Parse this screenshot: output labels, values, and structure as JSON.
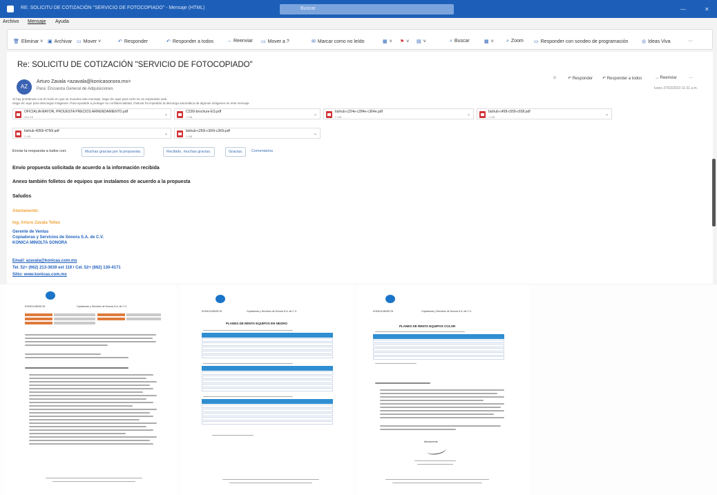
{
  "window": {
    "title": "RE: SOLICITU DE COTIZACIÓN \"SERVICIO DE FOTOCOPIADO\" - Mensaje (HTML)",
    "search_placeholder": "Buscar",
    "min": "—",
    "close": "✕"
  },
  "menu": [
    "Archivo",
    "Mensaje",
    "Ayuda"
  ],
  "ribbon": [
    {
      "icon": "trash-icon",
      "glyph": "🗑",
      "label": "Eliminar ˅"
    },
    {
      "icon": "archive-icon",
      "glyph": "▣",
      "label": "Archivar"
    },
    {
      "icon": "move-icon",
      "glyph": "▭",
      "label": "Mover ˅"
    },
    {
      "icon": "reply-icon",
      "glyph": "↶",
      "label": "Responder"
    },
    {
      "icon": "reply-all-icon",
      "glyph": "↶",
      "label": "Responder a todos"
    },
    {
      "icon": "forward-icon",
      "glyph": "→",
      "label": "Reenviar"
    },
    {
      "icon": "move-to-icon",
      "glyph": "▭",
      "label": "Mover a ?"
    },
    {
      "icon": "mark-read-icon",
      "glyph": "✉",
      "label": "Marcar como no leído"
    },
    {
      "icon": "categorize-icon",
      "glyph": "▦",
      "label": "˅"
    },
    {
      "icon": "flag-icon",
      "glyph": "⚑",
      "label": "˅"
    },
    {
      "icon": "more-icon",
      "glyph": "▤",
      "label": "˅"
    },
    {
      "icon": "find-icon",
      "glyph": "⌕",
      "label": "Buscar"
    },
    {
      "icon": "translate-icon",
      "glyph": "▦",
      "label": "˅"
    },
    {
      "icon": "zoom-icon",
      "glyph": "⌕",
      "label": "Zoom"
    },
    {
      "icon": "teams-reply-icon",
      "glyph": "▭",
      "label": "Responder con sondeo de programación"
    },
    {
      "icon": "ideas-icon",
      "glyph": "◎",
      "label": "Ideas Viva"
    },
    {
      "icon": "overflow-icon",
      "glyph": "",
      "label": "···"
    }
  ],
  "message": {
    "subject": "Re: SOLICITU DE COTIZACIÓN \"SERVICIO DE FOTOCOPIADO\"",
    "avatar": "AZ",
    "sender": "Arturo Zavala <azavala@konicasonora.mx>",
    "to": "Para: Encuesta General de Adquisiciones",
    "notice_1": "Si hay problemas con el modo en que se muestra este mensaje, haga clic aquí para verlo en un explorador web.",
    "notice_2": "Haga clic aquí para descargar imágenes. Para ayudarle a proteger su confidencialidad, Outlook ha impedido la descarga automática de algunas imágenes en este mensaje.",
    "datetime": "lunes 27/03/2023 11:31 a.m.",
    "actions": [
      "☺",
      "↶ Responder",
      "↶ Responder a todos",
      "→ Reenviar",
      "···"
    ],
    "attachments": [
      {
        "name": "OFICIALIA MAYOR, PROUESTA PRECIOS ARRENDAMIENTO.pdf",
        "size": "355 KB"
      },
      {
        "name": "C226i-brochure-ES.pdf",
        "size": "1 MB"
      },
      {
        "name": "bizhub-c224e-c284e-c364e.pdf",
        "size": "2 MB"
      },
      {
        "name": "bizhub-c458-c558-c658.pdf",
        "size": "1 MB"
      },
      {
        "name": "bizhub 4050i-4750i.pdf",
        "size": "2 MB"
      },
      {
        "name": "bizhub-c250i-c300i-c360i.pdf",
        "size": "4 MB"
      }
    ],
    "quick_replies": [
      "Enviar la respuesta a todos con:",
      "Muchas gracias por la propuesta.",
      "Recibido, muchas gracias.",
      "Gracias.",
      "Comentarios"
    ],
    "body": [
      "Envío propuesta solicitada de acuerdo a la información recibida",
      "Anexo también folletos de equipos que instalamos de acuerdo a la propuesta",
      "Saludos"
    ],
    "signature": {
      "greeting": "Atentamente:",
      "name": "Ing. Arturo Zavala Telles",
      "role": "Gerente de Ventas",
      "company": "Copiadoras y Servicios de Sonora S.A. de C.V.",
      "brand": "KONICA MINOLTA SONORA",
      "email": "Email: azavala@konicas.com.mx",
      "tel": "Tel. 52+ (662) 213-3639 ext 119 / Cel. 52+ (662) 130-4171",
      "web": "Sitio: www.konicas.com.mx"
    }
  },
  "documents": {
    "brand": "KONICA MINOLTA",
    "company": "Copiadoras y Servicios de Sonora S.A. de C.V.",
    "plan_title": "PLANES DE RENTA EQUIPOS EN NEGRO",
    "plan_title_color": "PLANES DE RENTA EQUIPOS COLOR",
    "firma": "Atentamente"
  },
  "colors": {
    "titlebar": "#1d5fb8",
    "accent": "#2a62b7",
    "signature_orange": "#f0a33a",
    "signature_blue": "#1f5fbf",
    "pdf_red": "#d13438"
  }
}
